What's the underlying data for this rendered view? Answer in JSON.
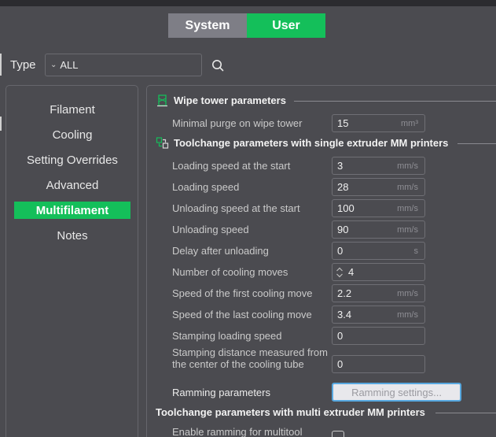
{
  "tabs": {
    "system": "System",
    "user": "User"
  },
  "filter": {
    "type_label": "Type",
    "type_value": "ALL"
  },
  "nav": {
    "items": [
      "Filament",
      "Cooling",
      "Setting Overrides",
      "Advanced",
      "Multifilament",
      "Notes"
    ],
    "active": "Multifilament"
  },
  "colors": {
    "accent": "#14bf5a",
    "system_tab": "#7e7e86",
    "background": "#4b4b50"
  },
  "sections": {
    "wipe_tower": {
      "title": "Wipe tower parameters",
      "icon": "wipe-tower-icon",
      "params": [
        {
          "label": "Minimal purge on wipe tower",
          "value": "15",
          "unit": "mm³"
        }
      ]
    },
    "single_extruder": {
      "title": "Toolchange parameters with single extruder MM printers",
      "icon": "toolchange-icon",
      "params": [
        {
          "label": "Loading speed at the start",
          "value": "3",
          "unit": "mm/s"
        },
        {
          "label": "Loading speed",
          "value": "28",
          "unit": "mm/s"
        },
        {
          "label": "Unloading speed at the start",
          "value": "100",
          "unit": "mm/s"
        },
        {
          "label": "Unloading speed",
          "value": "90",
          "unit": "mm/s"
        },
        {
          "label": "Delay after unloading",
          "value": "0",
          "unit": "s"
        },
        {
          "label": "Number of cooling moves",
          "value": "4",
          "unit": ""
        },
        {
          "label": "Speed of the first cooling move",
          "value": "2.2",
          "unit": "mm/s"
        },
        {
          "label": "Speed of the last cooling move",
          "value": "3.4",
          "unit": "mm/s"
        },
        {
          "label": "Stamping loading speed",
          "value": "0",
          "unit": ""
        },
        {
          "label": "Stamping distance measured from the center of the cooling tube",
          "value": "0",
          "unit": ""
        }
      ],
      "ramming_label": "Ramming parameters",
      "ramming_button": "Ramming settings..."
    },
    "multi_extruder": {
      "title": "Toolchange parameters with multi extruder MM printers",
      "params": [
        {
          "label": "Enable ramming for multitool",
          "checked": false
        }
      ]
    }
  }
}
